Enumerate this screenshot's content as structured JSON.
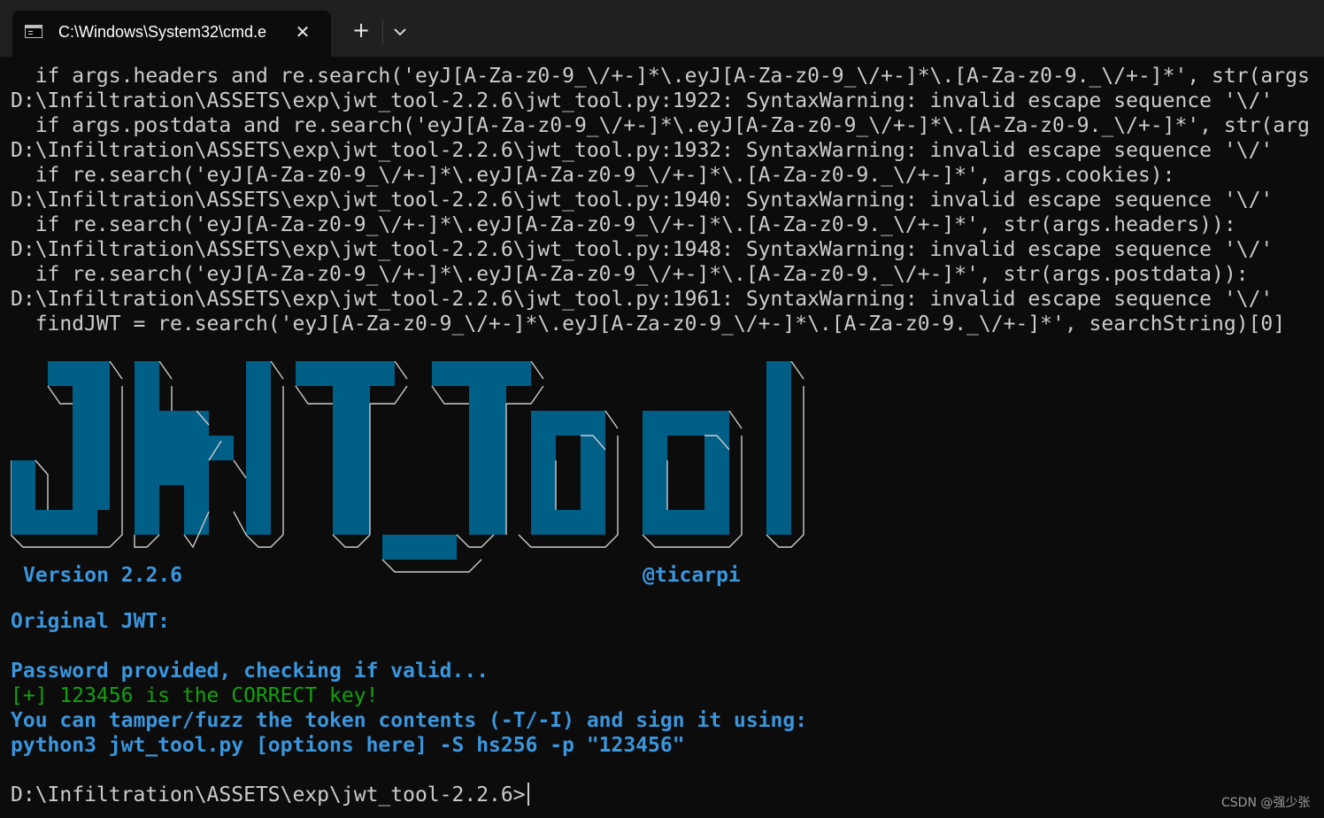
{
  "window": {
    "tab_title": "C:\\Windows\\System32\\cmd.e",
    "tab_icon": "terminal-icon",
    "close_icon": "close-icon",
    "new_tab_label": "+",
    "dropdown_icon": "chevron-down-icon"
  },
  "terminal": {
    "warnings": [
      "  if args.headers and re.search('eyJ[A-Za-z0-9_\\/+-]*\\.eyJ[A-Za-z0-9_\\/+-]*\\.[A-Za-z0-9._\\/+-]*', str(args",
      "D:\\Infiltration\\ASSETS\\exp\\jwt_tool-2.2.6\\jwt_tool.py:1922: SyntaxWarning: invalid escape sequence '\\/'",
      "  if args.postdata and re.search('eyJ[A-Za-z0-9_\\/+-]*\\.eyJ[A-Za-z0-9_\\/+-]*\\.[A-Za-z0-9._\\/+-]*', str(arg",
      "D:\\Infiltration\\ASSETS\\exp\\jwt_tool-2.2.6\\jwt_tool.py:1932: SyntaxWarning: invalid escape sequence '\\/'",
      "  if re.search('eyJ[A-Za-z0-9_\\/+-]*\\.eyJ[A-Za-z0-9_\\/+-]*\\.[A-Za-z0-9._\\/+-]*', args.cookies):",
      "D:\\Infiltration\\ASSETS\\exp\\jwt_tool-2.2.6\\jwt_tool.py:1940: SyntaxWarning: invalid escape sequence '\\/'",
      "  if re.search('eyJ[A-Za-z0-9_\\/+-]*\\.eyJ[A-Za-z0-9_\\/+-]*\\.[A-Za-z0-9._\\/+-]*', str(args.headers)):",
      "D:\\Infiltration\\ASSETS\\exp\\jwt_tool-2.2.6\\jwt_tool.py:1948: SyntaxWarning: invalid escape sequence '\\/'",
      "  if re.search('eyJ[A-Za-z0-9_\\/+-]*\\.eyJ[A-Za-z0-9_\\/+-]*\\.[A-Za-z0-9._\\/+-]*', str(args.postdata)):",
      "D:\\Infiltration\\ASSETS\\exp\\jwt_tool-2.2.6\\jwt_tool.py:1961: SyntaxWarning: invalid escape sequence '\\/'",
      "  findJWT = re.search('eyJ[A-Za-z0-9_\\/+-]*\\.eyJ[A-Za-z0-9_\\/+-]*\\.[A-Za-z0-9._\\/+-]*', searchString)[0]"
    ],
    "banner": {
      "logo_text": "JWT_Tool",
      "version": "Version 2.2.6",
      "author": "@ticarpi",
      "fill_color": "#005f87",
      "outline_color": "#cccccc"
    },
    "original_jwt_label": "Original JWT:",
    "password_message": "Password provided, checking if valid...",
    "success_message": "[+] 123456 is the CORRECT key!",
    "tamper_hint": "You can tamper/fuzz the token contents (-T/-I) and sign it using:",
    "sign_command": "python3 jwt_tool.py [options here] -S hs256 -p \"123456\"",
    "prompt": "D:\\Infiltration\\ASSETS\\exp\\jwt_tool-2.2.6>"
  },
  "watermark": "CSDN @强少张",
  "colors": {
    "background": "#0c0c0c",
    "titlebar": "#202020",
    "foreground": "#cccccc",
    "info_blue": "#3a96dd",
    "success_green": "#13a10e"
  }
}
